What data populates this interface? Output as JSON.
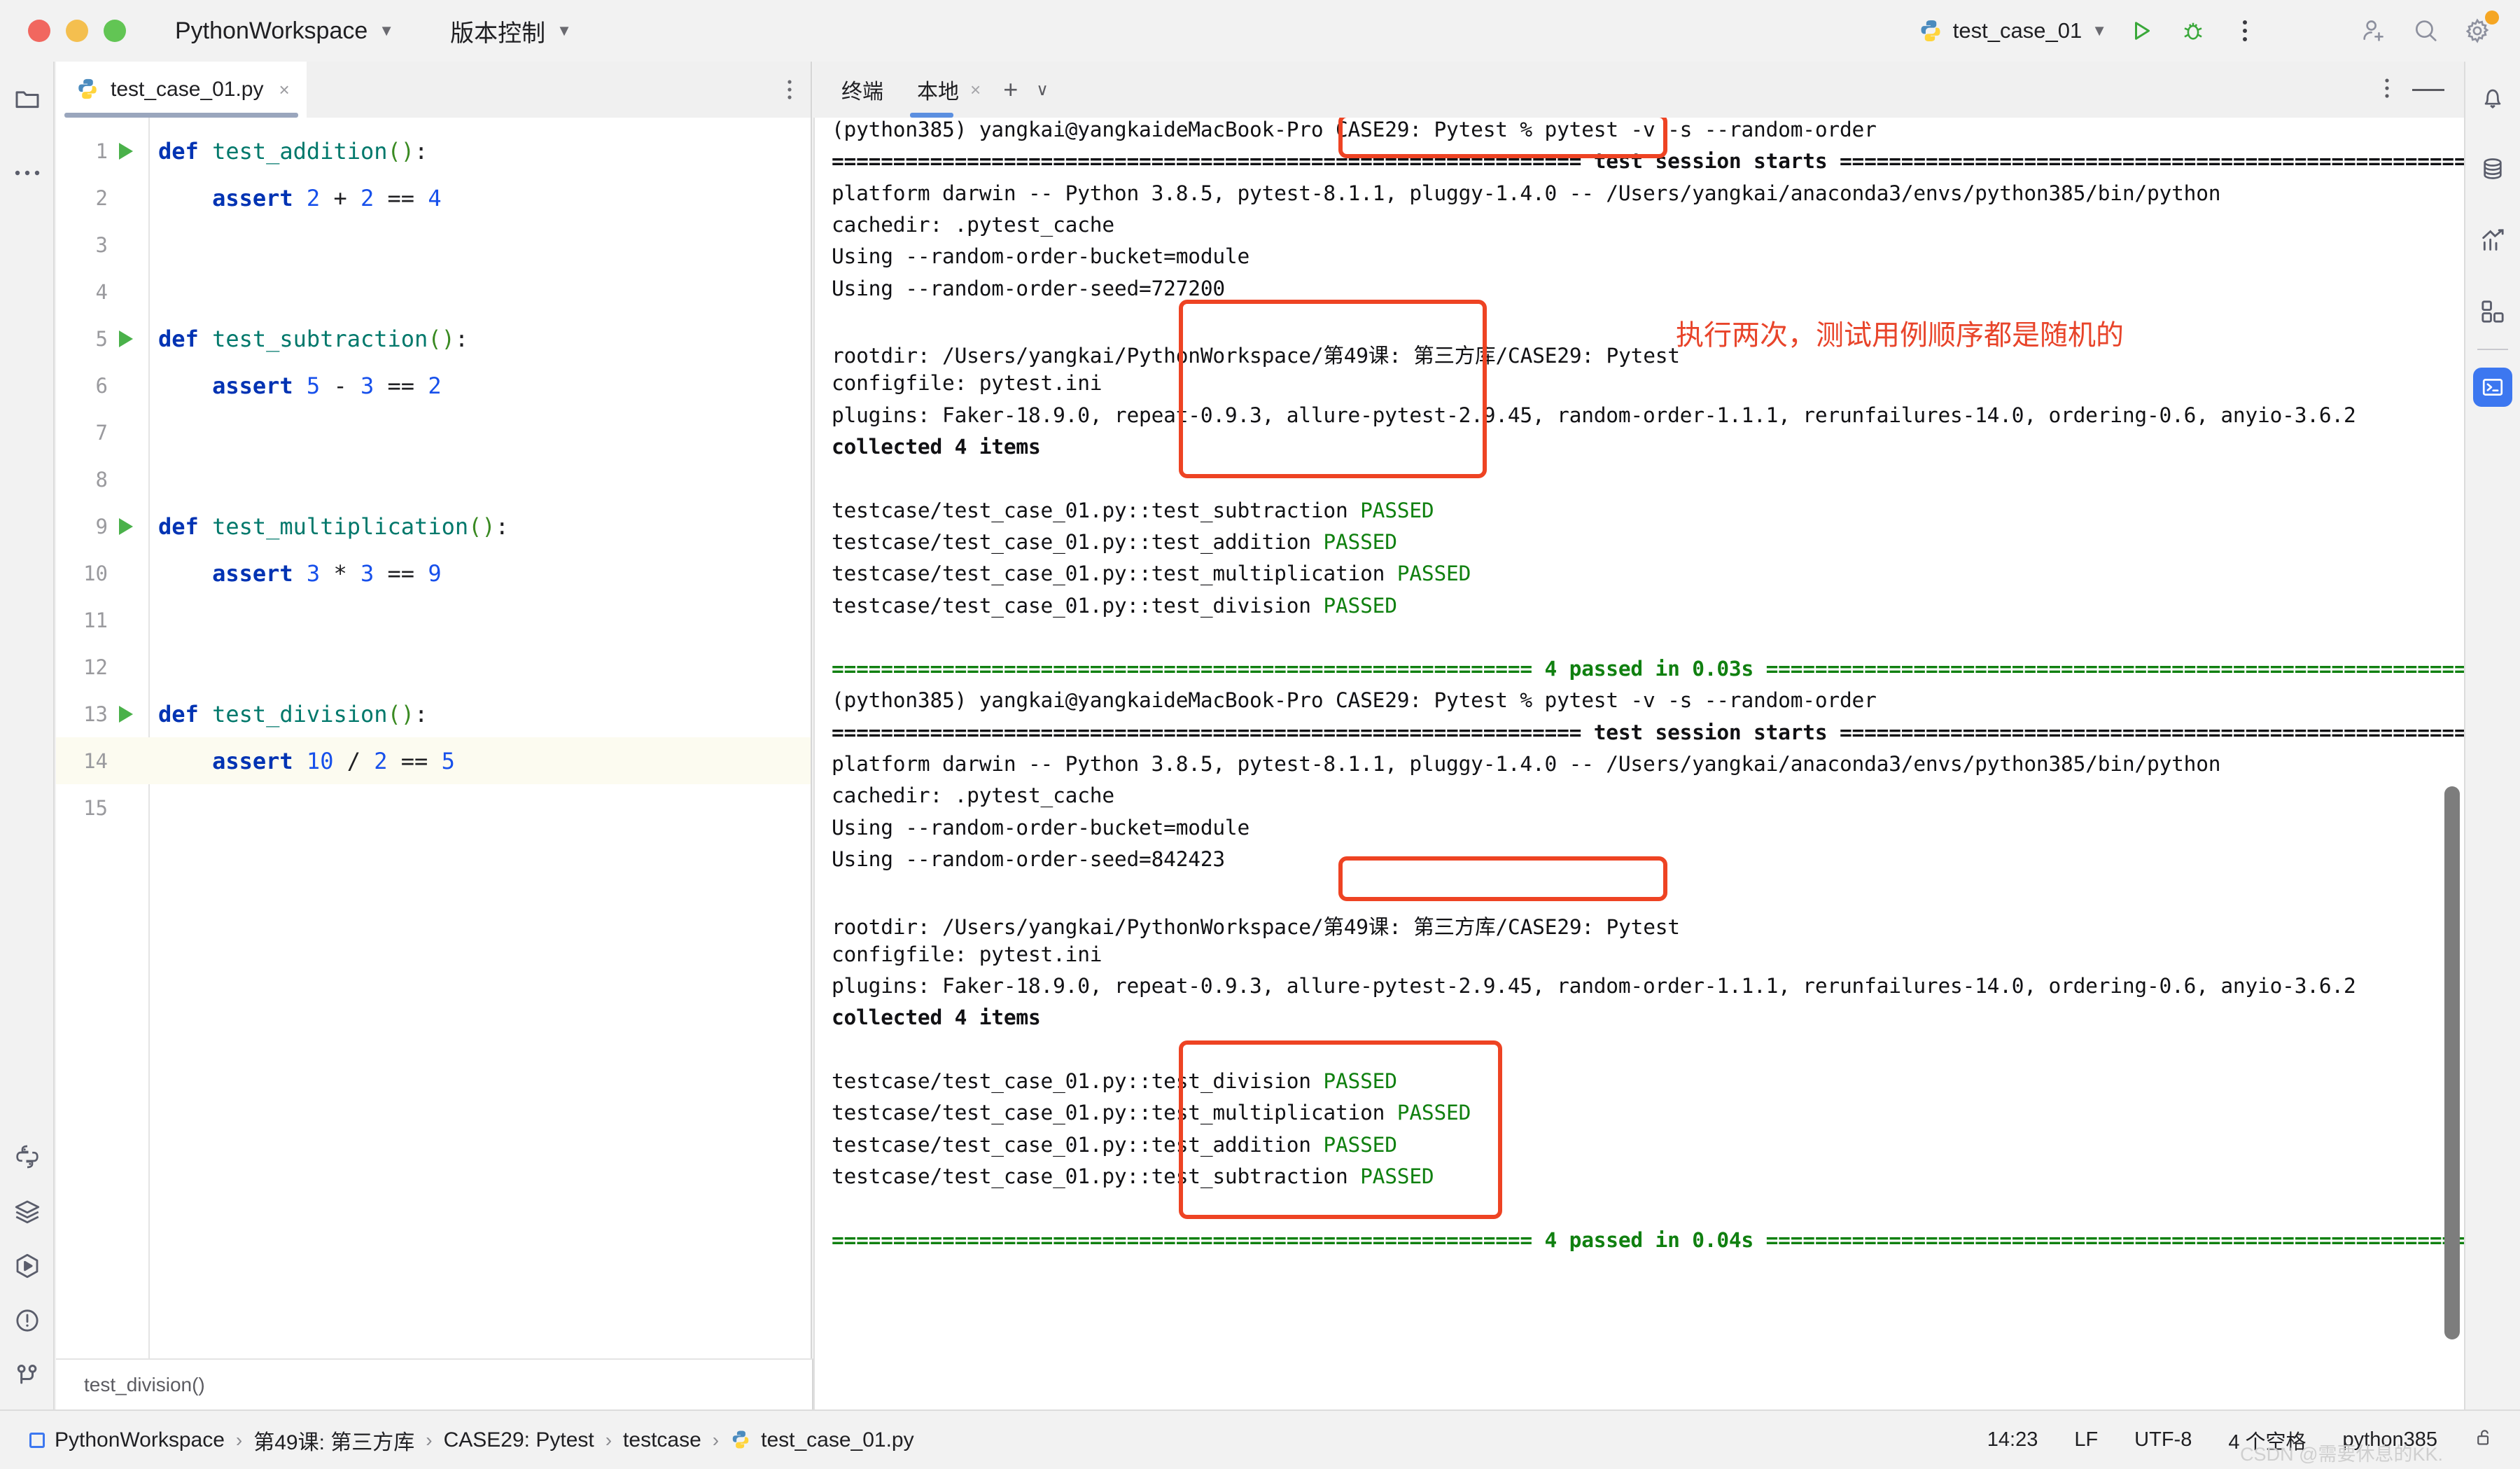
{
  "titlebar": {
    "project_name": "PythonWorkspace",
    "vcs_label": "版本控制",
    "run_config": "test_case_01",
    "icons": {
      "run": "run-icon",
      "debug": "debug-icon",
      "more": "more-vertical-icon",
      "add_user": "add-user-icon",
      "search": "search-icon",
      "settings": "settings-icon"
    }
  },
  "left_rail": {
    "items": [
      {
        "name": "project-folder-icon",
        "label": "项目"
      },
      {
        "name": "more-tool-windows-icon",
        "label": "更多"
      },
      {
        "name": "python-console-icon",
        "label": "Python 控制台"
      },
      {
        "name": "services-icon",
        "label": "服务"
      },
      {
        "name": "run-tool-icon",
        "label": "运行"
      },
      {
        "name": "problems-icon",
        "label": "问题"
      },
      {
        "name": "version-control-icon",
        "label": "版本控制"
      }
    ]
  },
  "right_rail": {
    "items": [
      {
        "name": "notifications-bell-icon",
        "label": "通知"
      },
      {
        "name": "database-icon",
        "label": "数据库"
      },
      {
        "name": "profiler-chart-icon",
        "label": "性能分析"
      },
      {
        "name": "plugins-grid-icon",
        "label": "插件"
      },
      {
        "name": "terminal-icon",
        "label": "终端",
        "active": true
      }
    ]
  },
  "editor": {
    "tab_label": "test_case_01.py",
    "tab_close": "×",
    "more_dots": "⋮",
    "breadcrumb_status": "test_division()",
    "lines": [
      {
        "n": "1",
        "run": true,
        "tokens": [
          [
            "kw",
            "def"
          ],
          [
            "op",
            " "
          ],
          [
            "fn",
            "test_addition"
          ],
          [
            "par",
            "()"
          ],
          [
            "op",
            ":"
          ]
        ]
      },
      {
        "n": "2",
        "run": false,
        "tokens": [
          [
            "op",
            "    "
          ],
          [
            "kw",
            "assert"
          ],
          [
            "op",
            " "
          ],
          [
            "num",
            "2"
          ],
          [
            "op",
            " + "
          ],
          [
            "num",
            "2"
          ],
          [
            "op",
            " == "
          ],
          [
            "num",
            "4"
          ]
        ]
      },
      {
        "n": "3",
        "run": false,
        "tokens": []
      },
      {
        "n": "4",
        "run": false,
        "tokens": []
      },
      {
        "n": "5",
        "run": true,
        "tokens": [
          [
            "kw",
            "def"
          ],
          [
            "op",
            " "
          ],
          [
            "fn",
            "test_subtraction"
          ],
          [
            "par",
            "()"
          ],
          [
            "op",
            ":"
          ]
        ]
      },
      {
        "n": "6",
        "run": false,
        "tokens": [
          [
            "op",
            "    "
          ],
          [
            "kw",
            "assert"
          ],
          [
            "op",
            " "
          ],
          [
            "num",
            "5"
          ],
          [
            "op",
            " - "
          ],
          [
            "num",
            "3"
          ],
          [
            "op",
            " == "
          ],
          [
            "num",
            "2"
          ]
        ]
      },
      {
        "n": "7",
        "run": false,
        "tokens": []
      },
      {
        "n": "8",
        "run": false,
        "tokens": []
      },
      {
        "n": "9",
        "run": true,
        "tokens": [
          [
            "kw",
            "def"
          ],
          [
            "op",
            " "
          ],
          [
            "fn",
            "test_multiplication"
          ],
          [
            "par",
            "()"
          ],
          [
            "op",
            ":"
          ]
        ]
      },
      {
        "n": "10",
        "run": false,
        "tokens": [
          [
            "op",
            "    "
          ],
          [
            "kw",
            "assert"
          ],
          [
            "op",
            " "
          ],
          [
            "num",
            "3"
          ],
          [
            "op",
            " * "
          ],
          [
            "num",
            "3"
          ],
          [
            "op",
            " == "
          ],
          [
            "num",
            "9"
          ]
        ]
      },
      {
        "n": "11",
        "run": false,
        "tokens": []
      },
      {
        "n": "12",
        "run": false,
        "tokens": []
      },
      {
        "n": "13",
        "run": true,
        "tokens": [
          [
            "kw",
            "def"
          ],
          [
            "op",
            " "
          ],
          [
            "fn",
            "test_division"
          ],
          [
            "par",
            "()"
          ],
          [
            "op",
            ":"
          ]
        ]
      },
      {
        "n": "14",
        "run": false,
        "hl": true,
        "tokens": [
          [
            "op",
            "    "
          ],
          [
            "kw",
            "assert"
          ],
          [
            "op",
            " "
          ],
          [
            "num",
            "10"
          ],
          [
            "op",
            " / "
          ],
          [
            "num",
            "2"
          ],
          [
            "op",
            " == "
          ],
          [
            "num",
            "5"
          ]
        ]
      },
      {
        "n": "15",
        "run": false,
        "tokens": []
      }
    ]
  },
  "terminal": {
    "panel_title": "终端",
    "tab_label": "本地",
    "tab_close": "×",
    "add_tab": "+",
    "dropdown": "∨",
    "options_icon": "more-vertical-icon",
    "minimize_icon": "minimize-icon",
    "success_check": "✔",
    "prompt": "(python385) yangkai@yangkaideMacBook-Pro CASE29: Pytest % ",
    "command": "pytest -v -s --random-order",
    "annotation": "执行两次，测试用例顺序都是随机的",
    "run1": {
      "session_header_left": "=============================================================",
      "session_header_text": " test session starts ",
      "session_header_right": "=============================================================",
      "platform": "platform darwin -- Python 3.8.5, pytest-8.1.1, pluggy-1.4.0 -- /Users/yangkai/anaconda3/envs/python385/bin/python",
      "cachedir": "cachedir: .pytest_cache",
      "bucket": "Using --random-order-bucket=module",
      "seed": "Using --random-order-seed=727200",
      "rootdir": "rootdir: /Users/yangkai/PythonWorkspace/第49课: 第三方库/CASE29: Pytest",
      "configfile": "configfile: pytest.ini",
      "plugins": "plugins: Faker-18.9.0, repeat-0.9.3, allure-pytest-2.9.45, random-order-1.1.1, rerunfailures-14.0, ordering-0.6, anyio-3.6.2",
      "collected": "collected 4 items",
      "tests": [
        {
          "path": "testcase/test_case_01.py::",
          "name": "test_subtraction",
          "status": "PASSED"
        },
        {
          "path": "testcase/test_case_01.py::",
          "name": "test_addition",
          "status": "PASSED"
        },
        {
          "path": "testcase/test_case_01.py::",
          "name": "test_multiplication",
          "status": "PASSED"
        },
        {
          "path": "testcase/test_case_01.py::",
          "name": "test_division",
          "status": "PASSED"
        }
      ],
      "summary_left": "=========================================================",
      "summary_text": " 4 passed in 0.03s ",
      "summary_right": "=========================================================="
    },
    "run2": {
      "session_header_left": "=============================================================",
      "session_header_text": " test session starts ",
      "session_header_right": "=============================================================",
      "platform": "platform darwin -- Python 3.8.5, pytest-8.1.1, pluggy-1.4.0 -- /Users/yangkai/anaconda3/envs/python385/bin/python",
      "cachedir": "cachedir: .pytest_cache",
      "bucket": "Using --random-order-bucket=module",
      "seed": "Using --random-order-seed=842423",
      "rootdir": "rootdir: /Users/yangkai/PythonWorkspace/第49课: 第三方库/CASE29: Pytest",
      "configfile": "configfile: pytest.ini",
      "plugins": "plugins: Faker-18.9.0, repeat-0.9.3, allure-pytest-2.9.45, random-order-1.1.1, rerunfailures-14.0, ordering-0.6, anyio-3.6.2",
      "collected": "collected 4 items",
      "tests": [
        {
          "path": "testcase/test_case_01.py::",
          "name": "test_division",
          "status": "PASSED"
        },
        {
          "path": "testcase/test_case_01.py::",
          "name": "test_multiplication",
          "status": "PASSED"
        },
        {
          "path": "testcase/test_case_01.py::",
          "name": "test_addition",
          "status": "PASSED"
        },
        {
          "path": "testcase/test_case_01.py::",
          "name": "test_subtraction",
          "status": "PASSED"
        }
      ],
      "summary_left": "=========================================================",
      "summary_text": " 4 passed in 0.04s ",
      "summary_right": "=========================================================="
    }
  },
  "statusbar": {
    "breadcrumbs": [
      {
        "label": "PythonWorkspace",
        "icon": "project-square-icon"
      },
      {
        "label": "第49课: 第三方库",
        "icon": ""
      },
      {
        "label": "CASE29: Pytest",
        "icon": ""
      },
      {
        "label": "testcase",
        "icon": ""
      },
      {
        "label": "test_case_01.py",
        "icon": "python-file-icon"
      }
    ],
    "separator": "›",
    "position": "14:23",
    "line_ending": "LF",
    "encoding": "UTF-8",
    "indent": "4 个空格",
    "interpreter": "python385",
    "lock_icon": "lock-open-icon",
    "watermark": "CSDN @需要休息的KK."
  },
  "colors": {
    "accent_blue": "#3c77f0",
    "pass_green": "#108010",
    "annotation_red": "#e8442a",
    "box_red": "#ee4323"
  }
}
